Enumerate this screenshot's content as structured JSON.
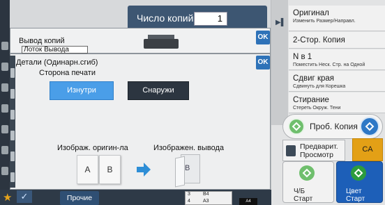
{
  "top": {
    "copies_label": "Число копий",
    "copies_value": "1"
  },
  "right_panel": {
    "items": [
      {
        "title": "Оригинал",
        "subtitle": "Изменить Размер/Направл."
      },
      {
        "title": "2-Стор. Копия",
        "subtitle": ""
      },
      {
        "title": "N в 1",
        "subtitle": "Поместить Неск. Стр. на Одной"
      },
      {
        "title": "Сдвиг края",
        "subtitle": "Сдвинуть для Корешка"
      },
      {
        "title": "Стирание",
        "subtitle": "Стереть Окруж. Тени"
      }
    ],
    "proof_copy": "Проб. Копия",
    "preview": {
      "line1": "Предварит.",
      "line2": "Просмотр"
    },
    "ca": "CA",
    "bw_start": {
      "line1": "Ч/Б",
      "line2": "Старт"
    },
    "color_start": {
      "line1": "Цвет",
      "line2": "Старт"
    }
  },
  "output_dialog": {
    "title": "Вывод копий",
    "tray": "Лоток Вывода",
    "ok": "OK"
  },
  "details_dialog": {
    "title": "Детали (Одинарн.сгиб)",
    "print_side_label": "Сторона печати",
    "options": [
      {
        "label": "Изнутри",
        "selected": true
      },
      {
        "label": "Снаружи",
        "selected": false
      }
    ],
    "ok": "OK",
    "original_label": "Изображ. оригин-ла",
    "output_label": "Изображен. вывода",
    "pages": [
      "A",
      "B"
    ],
    "output_page": "B"
  },
  "bottom_bar": {
    "other": "Прочие",
    "trays": [
      {
        "num": "3",
        "size": "B4"
      },
      {
        "num": "4",
        "size": "A3"
      }
    ],
    "paper": "A4"
  },
  "colors": {
    "accent_blue": "#2e72b8",
    "selected_option": "#4a9ee8",
    "ca_orange": "#e3a016",
    "color_start": "#1d5fb8"
  }
}
